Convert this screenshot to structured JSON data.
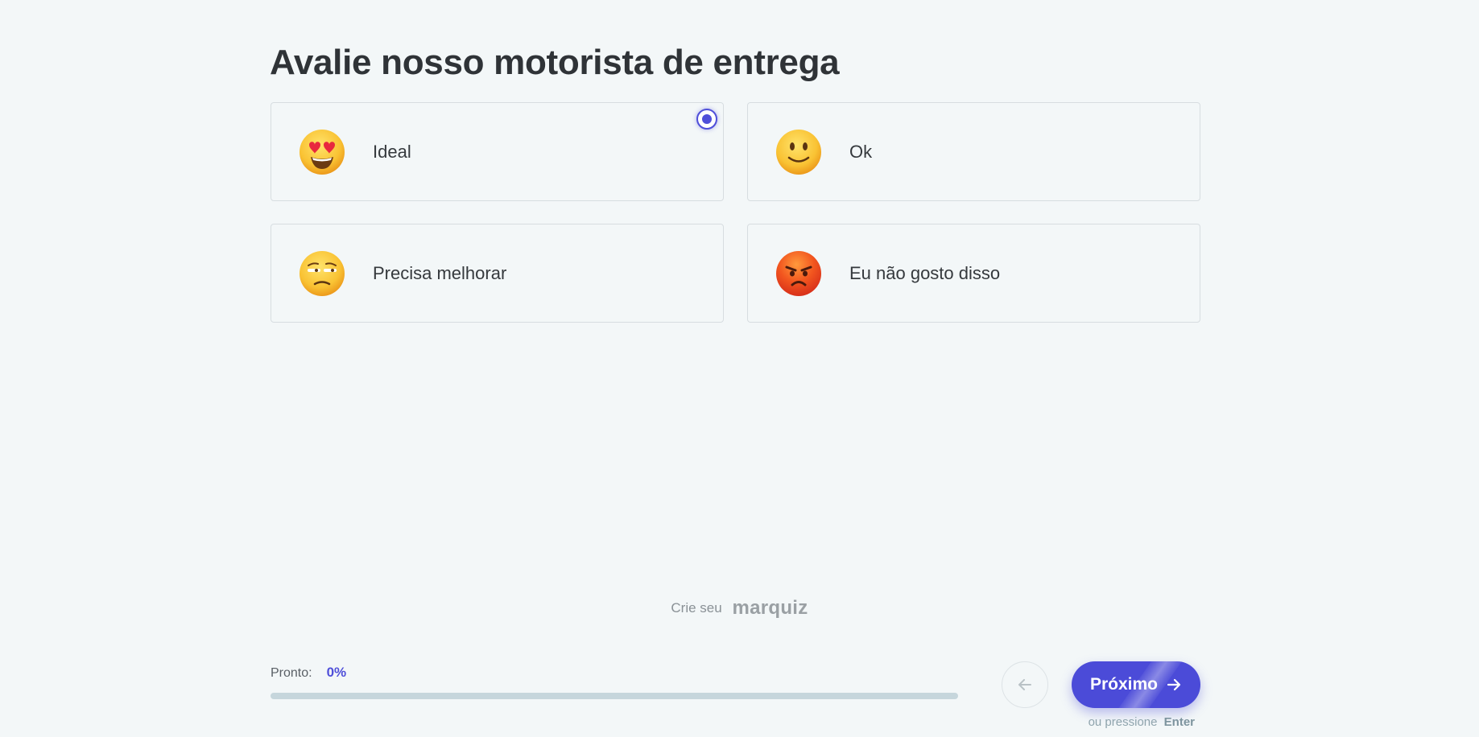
{
  "question": {
    "title": "Avalie nosso motorista de entrega"
  },
  "options": [
    {
      "label": "Ideal",
      "icon": "heart-eyes-emoji-icon",
      "selected": true
    },
    {
      "label": "Ok",
      "icon": "slightly-smiling-emoji-icon",
      "selected": false
    },
    {
      "label": "Precisa melhorar",
      "icon": "unamused-emoji-icon",
      "selected": false
    },
    {
      "label": "Eu não gosto disso",
      "icon": "angry-emoji-icon",
      "selected": false
    }
  ],
  "branding": {
    "prefix": "Crie seu",
    "name": "marquiz"
  },
  "progress": {
    "label": "Pronto:",
    "value_text": "0%",
    "percent": 0
  },
  "navigation": {
    "back_icon": "arrow-left-icon",
    "next_label": "Próximo",
    "next_icon": "arrow-right-icon",
    "hint_prefix": "ou pressione",
    "hint_key": "Enter"
  },
  "colors": {
    "accent": "#4b4bd8",
    "background": "#f3f7f8",
    "border": "#d7dde0",
    "progress_track": "#c6d6dc"
  }
}
